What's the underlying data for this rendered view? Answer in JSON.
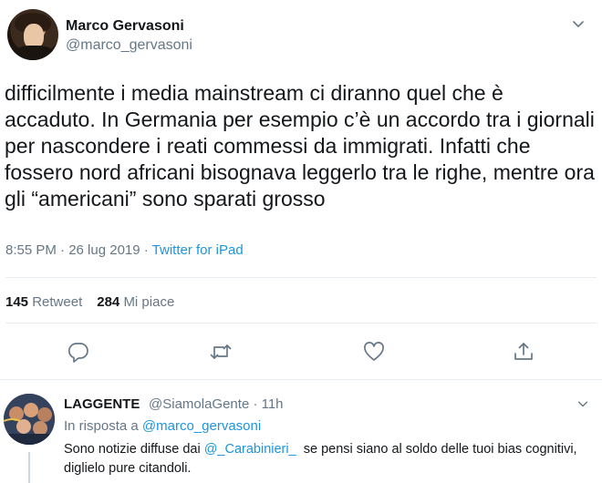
{
  "tweet": {
    "display_name": "Marco Gervasoni",
    "handle": "@marco_gervasoni",
    "text": "difficilmente i media mainstream ci diranno quel che è accaduto. In Germania per esempio c’è un accordo tra i giornali per nascondere i reati commessi da immigrati. Infatti che fossero nord africani bisognava leggerlo tra le righe, mentre ora gli “americani” sono sparati grosso",
    "timestamp": "8:55 PM · 26 lug 2019 · ",
    "source": "Twitter for iPad",
    "retweets_count": "145",
    "retweets_label": "Retweet",
    "likes_count": "284",
    "likes_label": "Mi piace"
  },
  "icons": {
    "reply": "reply-icon",
    "retweet": "retweet-icon",
    "like": "heart-icon",
    "share": "share-icon",
    "more": "chevron-down-icon"
  },
  "reply": {
    "display_name": "LAGGENTE",
    "handle_time": "@SiamolaGente · 11h",
    "in_reply_prefix": "In risposta a ",
    "in_reply_mention": "@marco_gervasoni",
    "text_prefix": "Sono notizie diffuse dai ",
    "text_mention": "@_Carabinieri_",
    "text_suffix": "  se pensi siano al soldo delle tuoi bias cognitivi, diglielo pure citandoli."
  },
  "colors": {
    "link": "#1b95e0",
    "muted": "#657786",
    "text": "#14171a",
    "divider": "#e6ecf0"
  }
}
